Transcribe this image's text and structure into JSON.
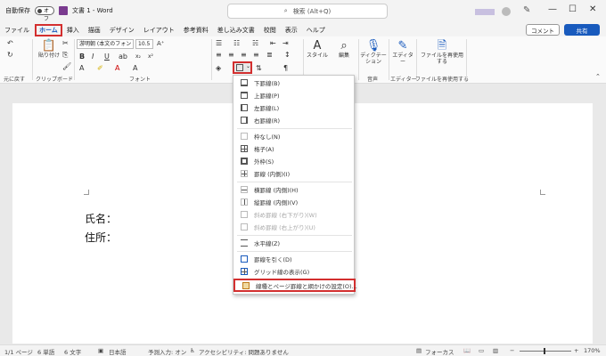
{
  "titlebar": {
    "autosave_label": "自動保存",
    "autosave_state": "オフ",
    "doc_title": "文書 1 - Word",
    "search_placeholder": "検索 (Alt+Q)",
    "minimize": "—",
    "maximize": "☐",
    "close": "✕"
  },
  "tabs": [
    "ファイル",
    "ホーム",
    "挿入",
    "描画",
    "デザイン",
    "レイアウト",
    "参考資料",
    "差し込み文書",
    "校閲",
    "表示",
    "ヘルプ"
  ],
  "actions": {
    "comment": "コメント",
    "share": "共有"
  },
  "ribbon": {
    "undo_label": "元に戻す",
    "paste_label": "貼り付け",
    "clipboard_label": "クリップボード",
    "font_name": "游明朝 (本文のフォント - 日本語)",
    "font_size": "10.5",
    "font_label": "フォント",
    "style_label": "スタイル",
    "edit_label": "編集",
    "dictation_label": "ディクテーション",
    "voice_label": "音声",
    "editor_label": "エディター",
    "editor_group": "エディター",
    "reuse_label": "ファイルを再使用する",
    "reuse_group": "ファイルを再使用する",
    "bold": "B",
    "italic": "I",
    "underline": "U"
  },
  "document": {
    "line1": "氏名：",
    "line2": "住所："
  },
  "border_menu": {
    "items": [
      "下罫線(B)",
      "上罫線(P)",
      "左罫線(L)",
      "右罫線(R)",
      "枠なし(N)",
      "格子(A)",
      "外枠(S)",
      "罫線 (内側)(I)",
      "横罫線 (内側)(H)",
      "縦罫線 (内側)(V)",
      "斜め罫線 (右下がり)(W)",
      "斜め罫線 (右上がり)(U)",
      "水平線(Z)",
      "罫線を引く(D)",
      "グリッド線の表示(G)",
      "線種とページ罫線と網かけの設定(O)..."
    ]
  },
  "status": {
    "page": "1/1 ページ",
    "words": "6 単語",
    "chars": "6 文字",
    "lang": "日本語",
    "predict": "予測入力: オン",
    "access": "アクセシビリティ: 問題ありません",
    "focus": "フォーカス",
    "zoom": "170%"
  }
}
